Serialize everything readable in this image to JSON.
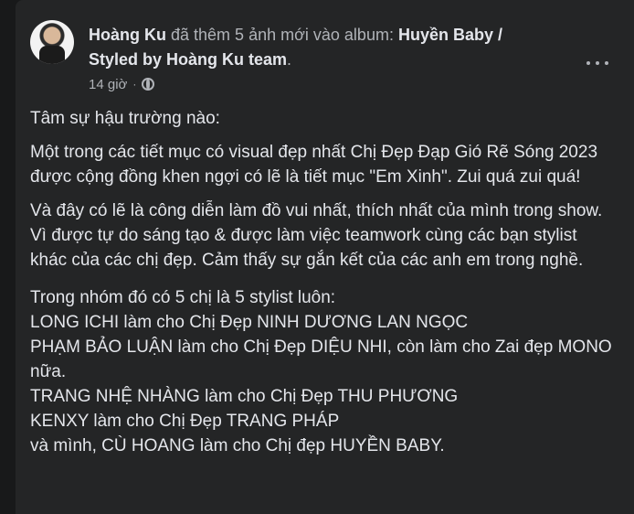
{
  "post": {
    "author": "Hoàng Ku",
    "action": "đã thêm 5 ảnh mới vào album:",
    "album_name": "Huyền Baby / Styled by Hoàng Ku team",
    "album_end": ".",
    "time": "14 giờ",
    "separator": "·",
    "privacy_icon": "globe-icon",
    "more_icon": "more-options-icon"
  },
  "content": {
    "p1": "Tâm sự hậu trường nào:",
    "p2": " Một trong các tiết mục có visual đẹp nhất Chị Đẹp Đạp Gió Rẽ Sóng 2023 được cộng đồng khen ngợi có lẽ là tiết mục \"Em Xinh\". Zui quá zui quá!",
    "p3": " Và đây có lẽ là công diễn làm đồ vui nhất, thích nhất của mình trong show. Vì được tự do sáng tạo & được làm việc teamwork cùng các bạn stylist khác của các chị đẹp. Cảm thấy sự gắn kết của các anh em trong nghề.",
    "list_intro": "Trong nhóm đó có 5 chị là 5 stylist luôn:",
    "lines": [
      "LONG ICHI làm cho Chị Đẹp NINH DƯƠNG LAN NGỌC",
      "PHẠM BẢO LUẬN làm cho Chị Đẹp DIỆU NHI, còn làm cho Zai đẹp MONO nữa.",
      "TRANG NHỆ NHÀNG làm cho Chị Đẹp THU PHƯƠNG",
      "KENXY làm cho Chị Đẹp TRANG PHÁP",
      "và mình, CÙ HOANG làm cho Chị đẹp HUYỀN BABY."
    ]
  }
}
